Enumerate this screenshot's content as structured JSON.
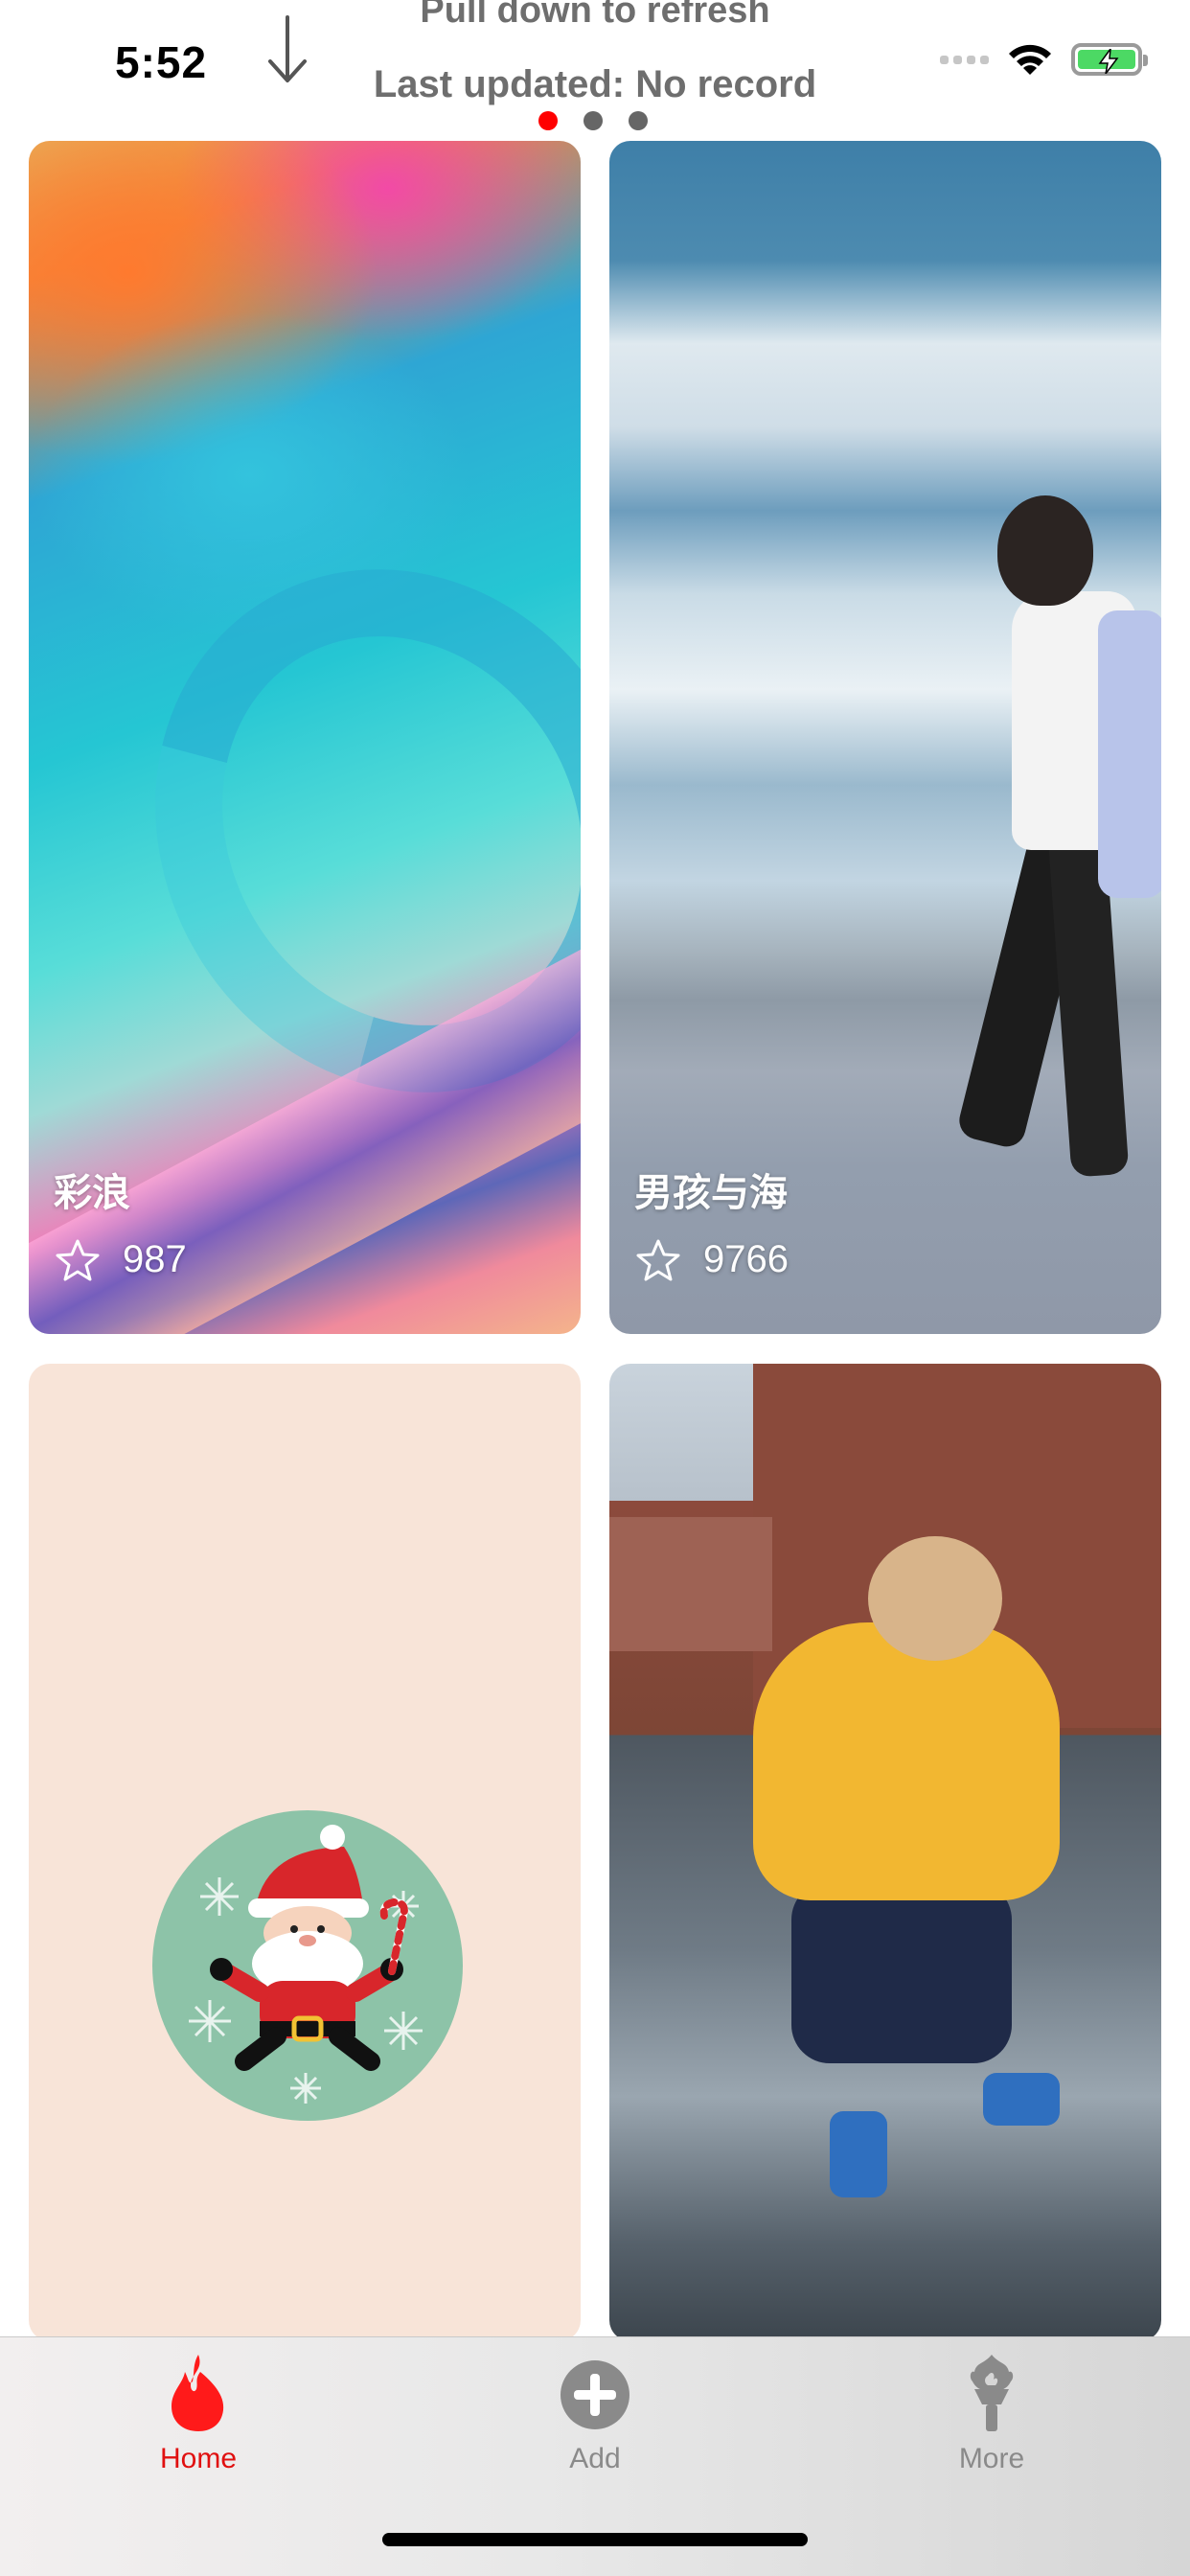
{
  "status_bar": {
    "time": "5:52",
    "battery_color": "#4cd964"
  },
  "refresh": {
    "title": "Pull down to refresh",
    "last_updated": "Last updated: No record",
    "arrow_icon": "arrow-down-icon"
  },
  "pager": {
    "pages": 3,
    "active_index": 0,
    "active_color": "#ff0000"
  },
  "cards": [
    {
      "title": "彩浪",
      "stars": "987"
    },
    {
      "title": "男孩与海",
      "stars": "9766"
    },
    {
      "title": "",
      "stars": ""
    },
    {
      "title": "",
      "stars": ""
    }
  ],
  "tabbar": {
    "accent_color": "#e01010",
    "tabs": [
      {
        "label": "Home",
        "icon": "flame-icon",
        "active": true
      },
      {
        "label": "Add",
        "icon": "plus-circle-icon",
        "active": false
      },
      {
        "label": "More",
        "icon": "torch-icon",
        "active": false
      }
    ]
  }
}
